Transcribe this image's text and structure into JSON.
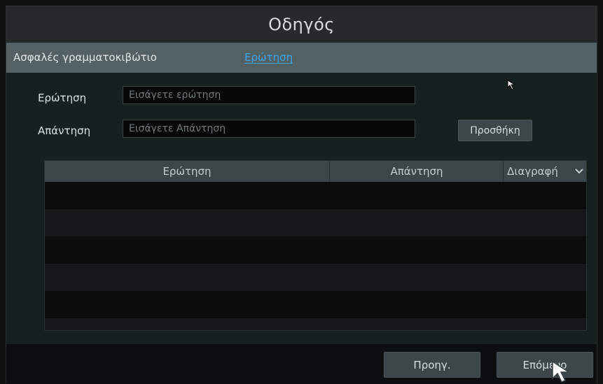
{
  "window": {
    "title": "Οδηγός"
  },
  "tabs": [
    {
      "label": "Ασφαλές γραμματοκιβώτιο",
      "active": false
    },
    {
      "label": "Ερώτηση",
      "active": true
    }
  ],
  "form": {
    "question_label": "Ερώτηση",
    "question_placeholder": "Εισάγετε ερώτηση",
    "answer_label": "Απάντηση",
    "answer_placeholder": "Εισάγετε Απάντηση",
    "add_button": "Προσθήκη"
  },
  "table": {
    "columns": [
      "Ερώτηση",
      "Απάντηση",
      "Διαγραφή"
    ],
    "rows": []
  },
  "footer": {
    "prev_button": "Προηγ.",
    "next_button": "Επόμενο"
  },
  "colors": {
    "accent": "#3aa6ea",
    "tabbar": "#536165",
    "background": "#16201e"
  },
  "icons": [
    "chevron-down-icon",
    "mouse-pointer-icon"
  ]
}
